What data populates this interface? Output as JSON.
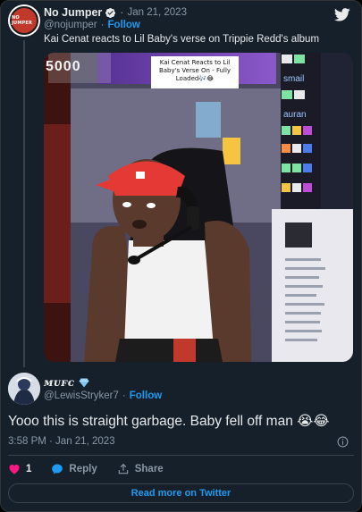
{
  "tweet": {
    "author_name": "No Jumper",
    "date": "Jan 21, 2023",
    "handle": "@nojumper",
    "follow_label": "Follow",
    "text": "Kai Cenat reacts to Lil Baby's verse on Trippie Redd's album",
    "avatar_logo_text": "NO JUMPER"
  },
  "media": {
    "overlay_caption": "Kai Cenat Reacts to Lil Baby's Verse On - Fully Loaded🎶😂",
    "sign_text": "5000",
    "chat_lines": [
      "smail",
      "auran"
    ]
  },
  "reply": {
    "author_name": "ᴍᴜꜰᴄ",
    "handle": "@LewisStryker7",
    "follow_label": "Follow",
    "text": "Yooo this is straight garbage. Baby fell off man 😭😂",
    "time": "3:58 PM · Jan 21, 2023",
    "like_count": "1",
    "reply_label": "Reply",
    "share_label": "Share",
    "read_more_label": "Read more on Twitter"
  },
  "colors": {
    "background": "#15202b",
    "accent": "#1d9bf0",
    "like": "#f91880",
    "muted": "#8b98a5"
  },
  "icons": {
    "verified": "verified-badge-icon",
    "twitter": "twitter-bird-icon",
    "diamond": "blue-diamond-icon",
    "info": "info-icon",
    "like": "heart-icon",
    "reply": "speech-bubble-icon",
    "share": "share-arrow-icon"
  }
}
